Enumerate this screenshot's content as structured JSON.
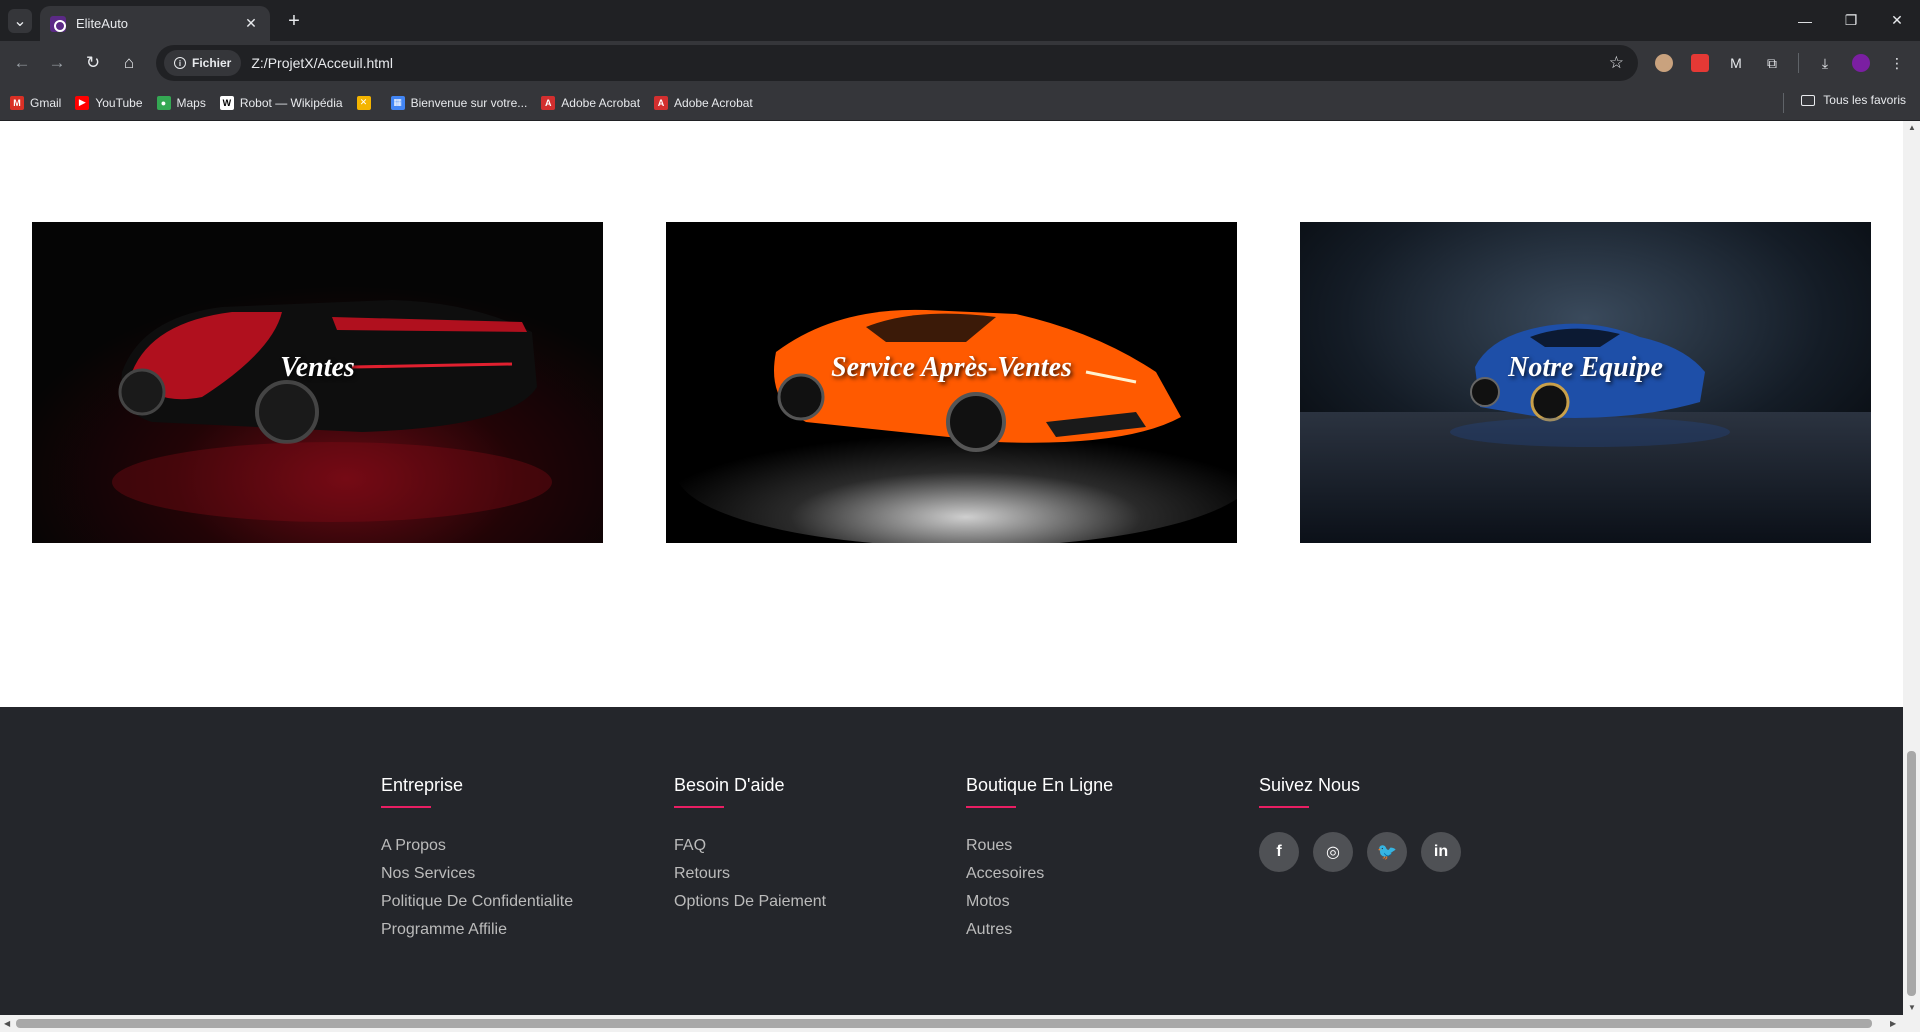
{
  "browser": {
    "tab_title": "EliteAuto",
    "chip_label": "Fichier",
    "url": "Z:/ProjetX/Acceuil.html",
    "bookmarks": [
      {
        "label": "Gmail",
        "color": "#d93025",
        "glyph": "M"
      },
      {
        "label": "YouTube",
        "color": "#ff0000",
        "glyph": "▶"
      },
      {
        "label": "Maps",
        "color": "#34a853",
        "glyph": "●"
      },
      {
        "label": "Robot — Wikipédia",
        "color": "#ffffff",
        "glyph": "W"
      },
      {
        "label": "",
        "color": "#f4b400",
        "glyph": "✕"
      },
      {
        "label": "Bienvenue sur votre...",
        "color": "#4285f4",
        "glyph": "▦"
      },
      {
        "label": "Adobe Acrobat",
        "color": "#d32f2f",
        "glyph": "A"
      },
      {
        "label": "Adobe Acrobat",
        "color": "#d32f2f",
        "glyph": "A"
      }
    ],
    "all_bookmarks": "Tous les favoris"
  },
  "cards": [
    {
      "label": "Ventes",
      "accent": "#c8102e"
    },
    {
      "label": "Service Après-Ventes",
      "accent": "#ff5a00"
    },
    {
      "label": "Notre Equipe",
      "accent": "#1e4fa8"
    }
  ],
  "footer": {
    "accent": "#e91e63",
    "columns": [
      {
        "title": "Entreprise",
        "links": [
          "A Propos",
          "Nos Services",
          "Politique De Confidentialite",
          "Programme Affilie"
        ]
      },
      {
        "title": "Besoin D'aide",
        "links": [
          "FAQ",
          "Retours",
          "Options De Paiement"
        ]
      },
      {
        "title": "Boutique En Ligne",
        "links": [
          "Roues",
          "Accesoires",
          "Motos",
          "Autres"
        ]
      },
      {
        "title": "Suivez Nous",
        "socials": [
          {
            "name": "facebook-icon",
            "glyph": "f"
          },
          {
            "name": "instagram-icon",
            "glyph": "◎"
          },
          {
            "name": "twitter-icon",
            "glyph": "🐦"
          },
          {
            "name": "linkedin-icon",
            "glyph": "in"
          }
        ]
      }
    ]
  }
}
